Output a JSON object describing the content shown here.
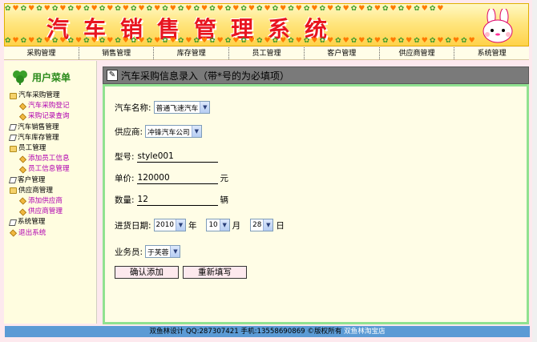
{
  "banner": {
    "title": "汽车销售管理系统"
  },
  "nav": [
    "采购管理",
    "销售管理",
    "库存管理",
    "员工管理",
    "客户管理",
    "供应商管理",
    "系统管理"
  ],
  "side": {
    "title": "用户菜单",
    "tree": [
      {
        "label": "汽车采购管理",
        "icon": "folder-icon",
        "sub": false
      },
      {
        "label": "汽车采购登记",
        "icon": "diamond-icon",
        "sub": true
      },
      {
        "label": "采购记录查询",
        "icon": "diamond-icon",
        "sub": true
      },
      {
        "label": "汽车销售管理",
        "icon": "doc-icon",
        "sub": false
      },
      {
        "label": "汽车库存管理",
        "icon": "doc-icon",
        "sub": false
      },
      {
        "label": "员工管理",
        "icon": "folder-icon",
        "sub": false
      },
      {
        "label": "添加员工信息",
        "icon": "diamond-icon",
        "sub": true
      },
      {
        "label": "员工信息管理",
        "icon": "diamond-icon",
        "sub": true
      },
      {
        "label": "客户管理",
        "icon": "doc-icon",
        "sub": false
      },
      {
        "label": "供应商管理",
        "icon": "folder-icon",
        "sub": false
      },
      {
        "label": "添加供应商",
        "icon": "diamond-icon",
        "sub": true
      },
      {
        "label": "供应商管理",
        "icon": "diamond-icon",
        "sub": true
      },
      {
        "label": "系统管理",
        "icon": "doc-icon",
        "sub": false
      },
      {
        "label": "退出系统",
        "icon": "diamond-icon",
        "sub": false
      }
    ]
  },
  "form": {
    "heading": "汽车采购信息录入（带*号的为必填项）",
    "car_name_label": "汽车名称:",
    "car_name_value": "普通飞速汽车",
    "supplier_label": "供应商:",
    "supplier_value": "冲锋汽车公司",
    "model_label": "型号:",
    "model_value": "style001",
    "price_label": "单价:",
    "price_value": "120000",
    "price_unit": "元",
    "qty_label": "数量:",
    "qty_value": "12",
    "qty_unit": "辆",
    "date_label": "进货日期:",
    "year_value": "2010",
    "year_unit": "年",
    "month_value": "10",
    "month_unit": "月",
    "day_value": "28",
    "day_unit": "日",
    "staff_label": "业务员:",
    "staff_value": "于芙蓉",
    "confirm_button": "确认添加",
    "reset_button": "重新填写"
  },
  "footer": {
    "text": "双鱼林设计  QQ:287307421 手机:13558690869 ©版权所有",
    "link": "双鱼林淘宝店"
  }
}
